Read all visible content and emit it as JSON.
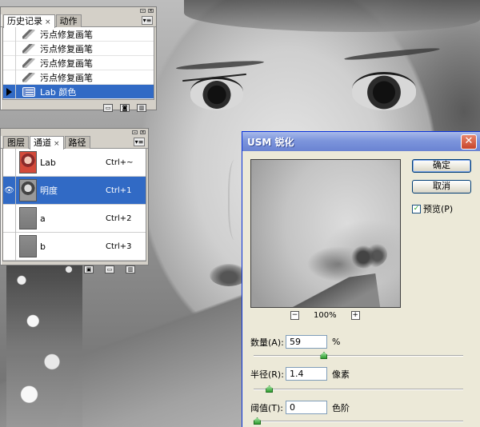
{
  "history": {
    "tabs": [
      {
        "label": "历史记录",
        "close": "×"
      },
      {
        "label": "动作"
      }
    ],
    "menu_glyph": "▾≡",
    "items": [
      {
        "label": "污点修复画笔"
      },
      {
        "label": "污点修复画笔"
      },
      {
        "label": "污点修复画笔"
      },
      {
        "label": "污点修复画笔"
      },
      {
        "label": "Lab 颜色"
      }
    ]
  },
  "channels": {
    "tabs": [
      {
        "label": "图层"
      },
      {
        "label": "通道",
        "close": "×"
      },
      {
        "label": "路径"
      }
    ],
    "menu_glyph": "▾≡",
    "items": [
      {
        "name": "Lab",
        "shortcut": "Ctrl+~"
      },
      {
        "name": "明度",
        "shortcut": "Ctrl+1"
      },
      {
        "name": "a",
        "shortcut": "Ctrl+2"
      },
      {
        "name": "b",
        "shortcut": "Ctrl+3"
      }
    ],
    "visibility_glyph": "👁"
  },
  "dialog": {
    "title": "USM 锐化",
    "close_glyph": "✕",
    "ok_label": "确定",
    "cancel_label": "取消",
    "preview_label": "预览(P)",
    "preview_checked": true,
    "zoom_minus": "−",
    "zoom_plus": "+",
    "zoom_level": "100%",
    "amount": {
      "label": "数量(A):",
      "value": "59",
      "unit": "%",
      "slider_fraction": 0.33
    },
    "radius": {
      "label": "半径(R):",
      "value": "1.4",
      "unit": "像素",
      "slider_fraction": 0.06
    },
    "threshold": {
      "label": "阈值(T):",
      "value": "0",
      "unit": "色阶",
      "slider_fraction": 0.0
    }
  },
  "colors": {
    "selection": "#316ac5",
    "title_gradient": "#7d95dc",
    "slider_knob": "#2f9e2f"
  }
}
